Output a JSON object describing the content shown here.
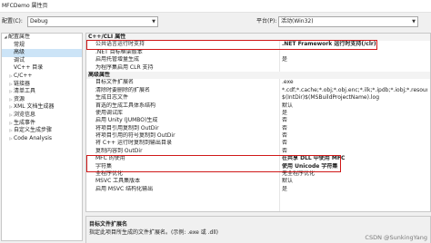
{
  "window": {
    "title": "MFCDemo 属性页"
  },
  "toolbar": {
    "config_label": "配置(C):",
    "config_value": "Debug",
    "platform_label": "平台(P):",
    "platform_value": "活动(Win32)"
  },
  "tree": {
    "items": [
      {
        "label": "配置属性",
        "expander": "◢"
      },
      {
        "label": "常规",
        "expander": ""
      },
      {
        "label": "高级",
        "expander": ""
      },
      {
        "label": "调试",
        "expander": ""
      },
      {
        "label": "VC++ 目录",
        "expander": ""
      },
      {
        "label": "C/C++",
        "expander": "▷"
      },
      {
        "label": "链接器",
        "expander": "▷"
      },
      {
        "label": "清单工具",
        "expander": "▷"
      },
      {
        "label": "资源",
        "expander": "▷"
      },
      {
        "label": "XML 文档生成器",
        "expander": "▷"
      },
      {
        "label": "浏览信息",
        "expander": "▷"
      },
      {
        "label": "生成事件",
        "expander": "▷"
      },
      {
        "label": "自定义生成步骤",
        "expander": "▷"
      },
      {
        "label": "Code Analysis",
        "expander": "▷"
      }
    ]
  },
  "grid": {
    "rows": [
      {
        "name": "C++/CLI 属性",
        "value": ""
      },
      {
        "name": "公共语言运行时支持",
        "value": ".NET Framework 运行时支持(/clr)"
      },
      {
        "name": ".NET 目标框架版本",
        "value": ""
      },
      {
        "name": "启用托管增量生成",
        "value": "是"
      },
      {
        "name": "为程序集启用 CLR 支持",
        "value": ""
      },
      {
        "name": "高级属性",
        "value": ""
      },
      {
        "name": "目标文件扩展名",
        "value": ".exe"
      },
      {
        "name": "清除时要删除的扩展名",
        "value": "*.cdf;*.cache;*.obj;*.obj.enc;*.ilk;*.ipdb;*.iobj;*.resources;*.tl"
      },
      {
        "name": "生成日志文件",
        "value": "$(IntDir)$(MSBuildProjectName).log"
      },
      {
        "name": "首选的生成工具体系结构",
        "value": "默认"
      },
      {
        "name": "使用调试库",
        "value": "是"
      },
      {
        "name": "启用 Unity (JUMBO)生成",
        "value": "否"
      },
      {
        "name": "将项目引用复制到 OutDir",
        "value": "否"
      },
      {
        "name": "将项目引用的符号复制到 OutDir",
        "value": "否"
      },
      {
        "name": "将 C++ 运行时复制到输出目录",
        "value": "否"
      },
      {
        "name": "复制内容到 OutDir",
        "value": "否"
      },
      {
        "name": "MFC 的使用",
        "value": "在共享 DLL 中使用 MFC"
      },
      {
        "name": "字符集",
        "value": "使用 Unicode 字符集"
      },
      {
        "name": "全程序优化",
        "value": "无全程序优化"
      },
      {
        "name": "MSVC 工具集版本",
        "value": "默认"
      },
      {
        "name": "启用 MSVC 结构化输出",
        "value": "是"
      }
    ]
  },
  "description": {
    "title": "目标文件扩展名",
    "text": "指定此项目所生成的文件扩展名。(示例: .exe 或 .dll)"
  },
  "watermark": "CSDN @SunkingYang",
  "colors": {
    "highlight_border": "#d01818",
    "tree_selection": "#cce4f7"
  }
}
